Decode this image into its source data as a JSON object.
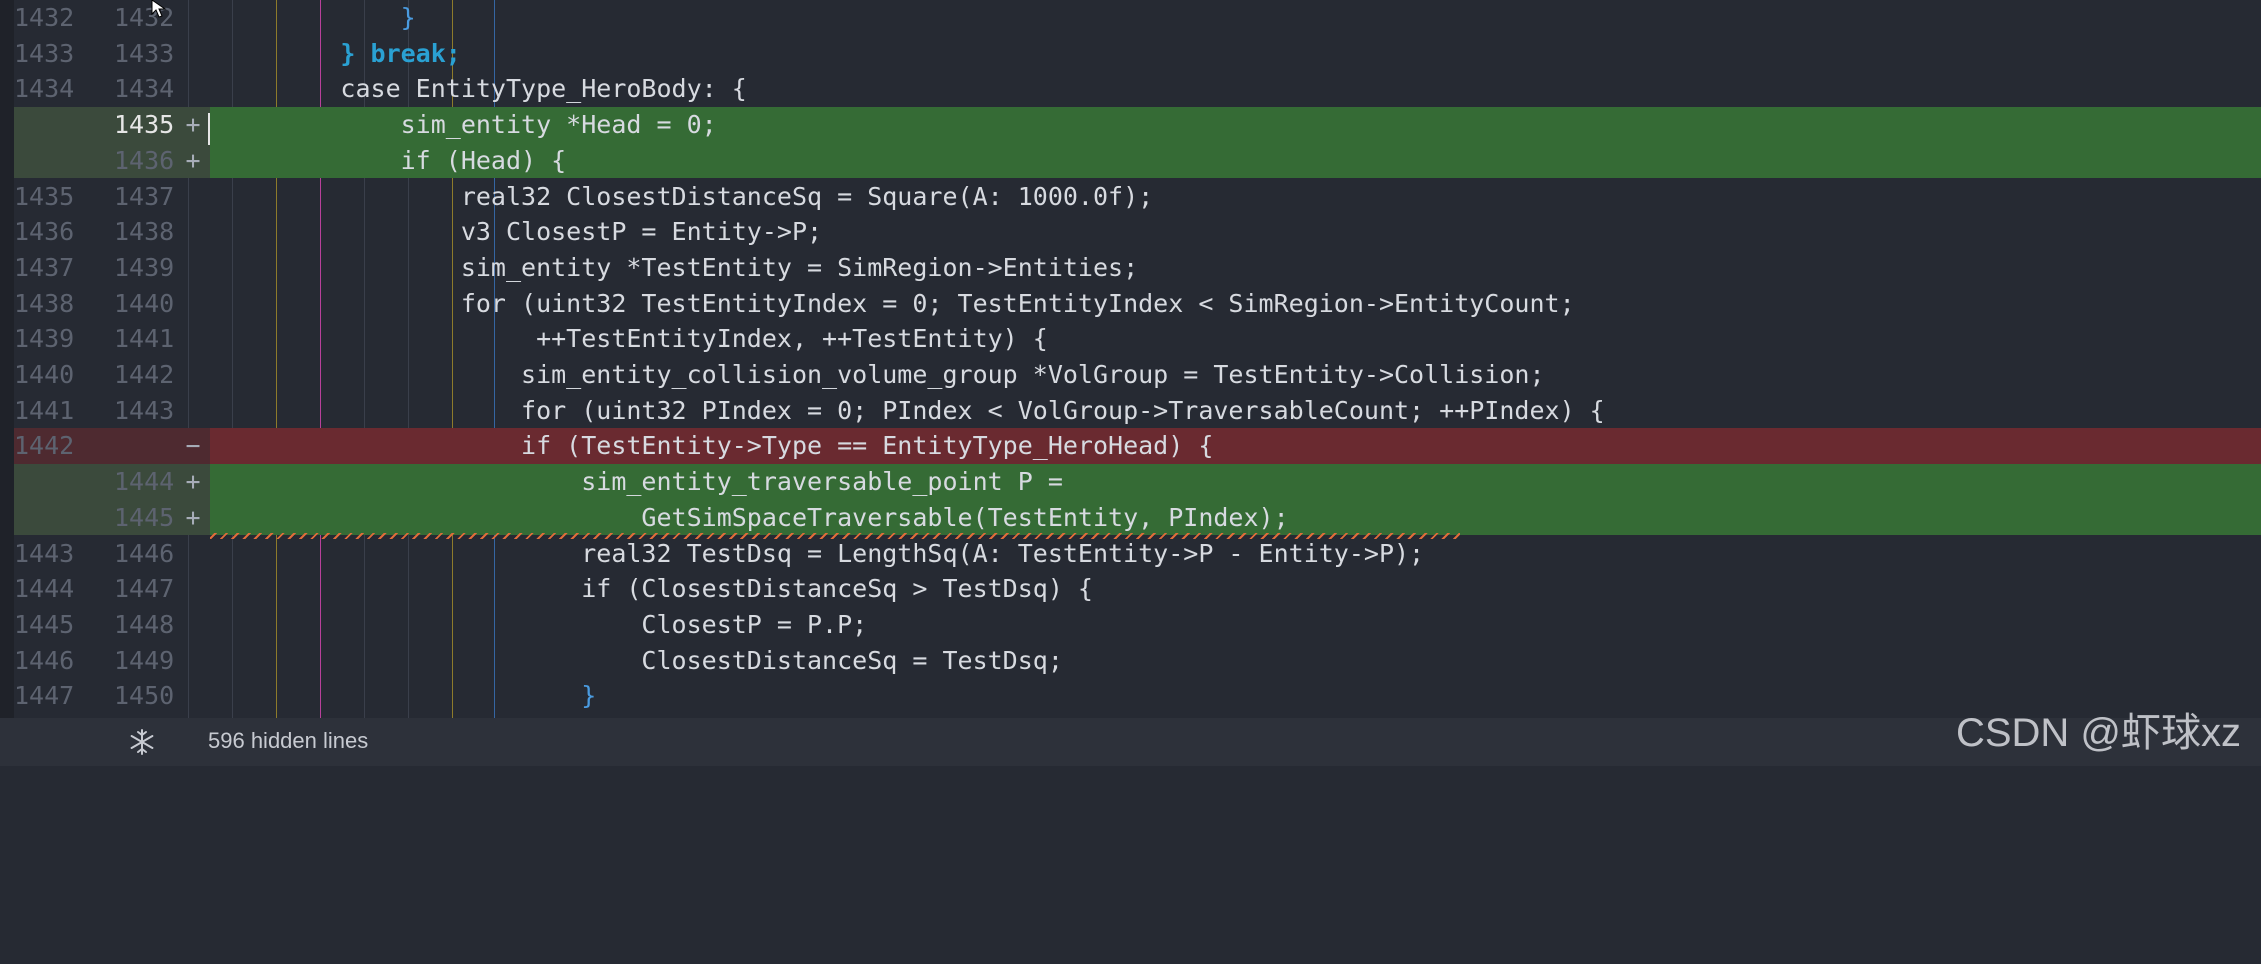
{
  "editor": {
    "lines": [
      {
        "old": "1432",
        "new": "1432",
        "marker": "",
        "type": "context",
        "code": "            }"
      },
      {
        "old": "1433",
        "new": "1433",
        "marker": "",
        "type": "context",
        "code": "        } break;"
      },
      {
        "old": "1434",
        "new": "1434",
        "marker": "",
        "type": "context",
        "code": "        case EntityType_HeroBody: {"
      },
      {
        "old": "",
        "new": "1435",
        "marker": "+",
        "type": "added",
        "code": "            sim_entity *Head = 0;"
      },
      {
        "old": "",
        "new": "1436",
        "marker": "+",
        "type": "added",
        "code": "            if (Head) {"
      },
      {
        "old": "1435",
        "new": "1437",
        "marker": "",
        "type": "context",
        "code": "                real32 ClosestDistanceSq = Square(A: 1000.0f);"
      },
      {
        "old": "1436",
        "new": "1438",
        "marker": "",
        "type": "context",
        "code": "                v3 ClosestP = Entity->P;"
      },
      {
        "old": "1437",
        "new": "1439",
        "marker": "",
        "type": "context",
        "code": "                sim_entity *TestEntity = SimRegion->Entities;"
      },
      {
        "old": "1438",
        "new": "1440",
        "marker": "",
        "type": "context",
        "code": "                for (uint32 TestEntityIndex = 0; TestEntityIndex < SimRegion->EntityCount;"
      },
      {
        "old": "1439",
        "new": "1441",
        "marker": "",
        "type": "context",
        "code": "                     ++TestEntityIndex, ++TestEntity) {"
      },
      {
        "old": "1440",
        "new": "1442",
        "marker": "",
        "type": "context",
        "code": "                    sim_entity_collision_volume_group *VolGroup = TestEntity->Collision;"
      },
      {
        "old": "1441",
        "new": "1443",
        "marker": "",
        "type": "context",
        "code": "                    for (uint32 PIndex = 0; PIndex < VolGroup->TraversableCount; ++PIndex) {"
      },
      {
        "old": "1442",
        "new": "",
        "marker": "−",
        "type": "removed",
        "code": "                    if (TestEntity->Type == EntityType_HeroHead) {"
      },
      {
        "old": "",
        "new": "1444",
        "marker": "+",
        "type": "added",
        "code": "                        sim_entity_traversable_point P ="
      },
      {
        "old": "",
        "new": "1445",
        "marker": "+",
        "type": "added",
        "code": "                            GetSimSpaceTraversable(TestEntity, PIndex);"
      },
      {
        "old": "1443",
        "new": "1446",
        "marker": "",
        "type": "context",
        "code": "                        real32 TestDsq = LengthSq(A: TestEntity->P - Entity->P);"
      },
      {
        "old": "1444",
        "new": "1447",
        "marker": "",
        "type": "context",
        "code": "                        if (ClosestDistanceSq > TestDsq) {"
      },
      {
        "old": "1445",
        "new": "1448",
        "marker": "",
        "type": "context",
        "code": "                            ClosestP = P.P;"
      },
      {
        "old": "1446",
        "new": "1449",
        "marker": "",
        "type": "context",
        "code": "                            ClosestDistanceSq = TestDsq;"
      },
      {
        "old": "1447",
        "new": "1450",
        "marker": "",
        "type": "context",
        "code": "                        }"
      }
    ]
  },
  "status_bar": {
    "icon": "snowflake-icon",
    "hidden_lines_label": "596 hidden lines"
  },
  "watermark": "CSDN @虾球xz",
  "colors": {
    "background": "#262a33",
    "added_line": "#356b35",
    "removed_line": "#6a2a30",
    "keyword": "#2aa1d3",
    "number": "#5fc1d6"
  }
}
